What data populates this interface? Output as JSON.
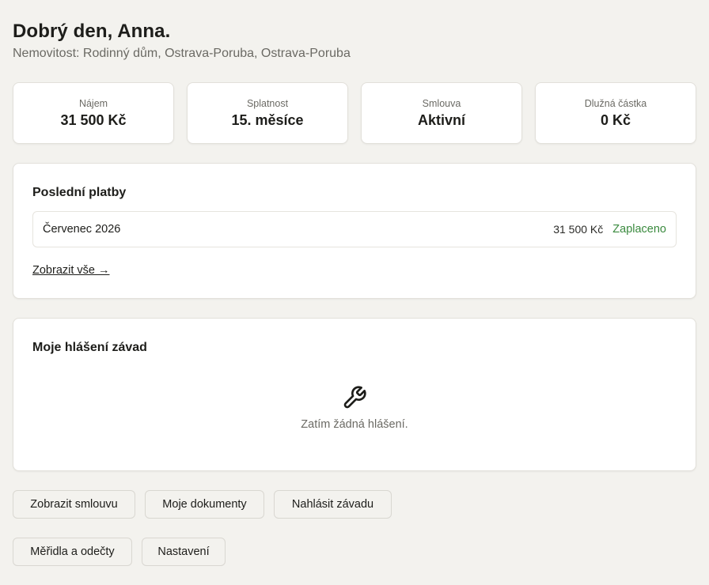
{
  "header": {
    "greeting": "Dobrý den, Anna.",
    "property": "Nemovitost: Rodinný dům, Ostrava-Poruba, Ostrava-Poruba"
  },
  "stats": [
    {
      "label": "Nájem",
      "value": "31 500 Kč"
    },
    {
      "label": "Splatnost",
      "value": "15. měsíce"
    },
    {
      "label": "Smlouva",
      "value": "Aktivní"
    },
    {
      "label": "Dlužná částka",
      "value": "0 Kč"
    }
  ],
  "payments": {
    "title": "Poslední platby",
    "rows": [
      {
        "month": "Červenec 2026",
        "amount": "31 500 Kč",
        "status": "Zaplaceno"
      }
    ],
    "show_all": "Zobrazit vše →"
  },
  "faults": {
    "title": "Moje hlášení závad",
    "empty_icon": "wrench-icon",
    "empty_text": "Zatím žádná hlášení."
  },
  "actions": {
    "view_contract": "Zobrazit smlouvu",
    "my_documents": "Moje dokumenty",
    "report_fault": "Nahlásit závadu",
    "meters": "Měřidla a odečty",
    "settings": "Nastavení"
  },
  "colors": {
    "background": "#f3f2ee",
    "paid_status": "#3a8a3e"
  }
}
